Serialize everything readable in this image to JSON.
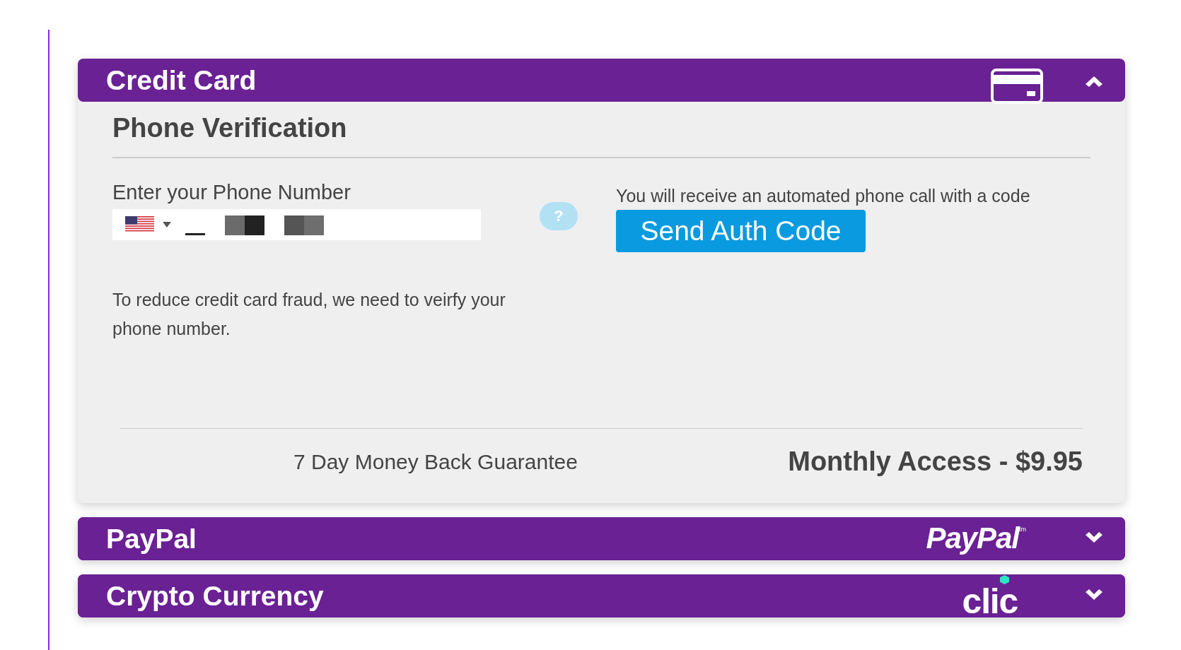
{
  "payment_sections": [
    {
      "title": "Credit Card",
      "expanded": true,
      "logo": {
        "kind": "card"
      },
      "content": {
        "heading": "Phone Verification",
        "phone_label": "Enter your Phone Number",
        "help": "?",
        "notice": "You will receive an automated phone call with a code",
        "send_button": "Send Auth Code",
        "explanation": "To reduce credit card fraud, we need to veirfy your phone number.",
        "guarantee": "7 Day Money Back Guarantee",
        "price": "Monthly Access - $9.95"
      }
    },
    {
      "title": "PayPal",
      "expanded": false,
      "logo": {
        "kind": "paypal",
        "text": "PayPal",
        "mark": "tm"
      }
    },
    {
      "title": "Crypto Currency",
      "expanded": false,
      "logo": {
        "kind": "clic",
        "text": "clic"
      }
    }
  ]
}
